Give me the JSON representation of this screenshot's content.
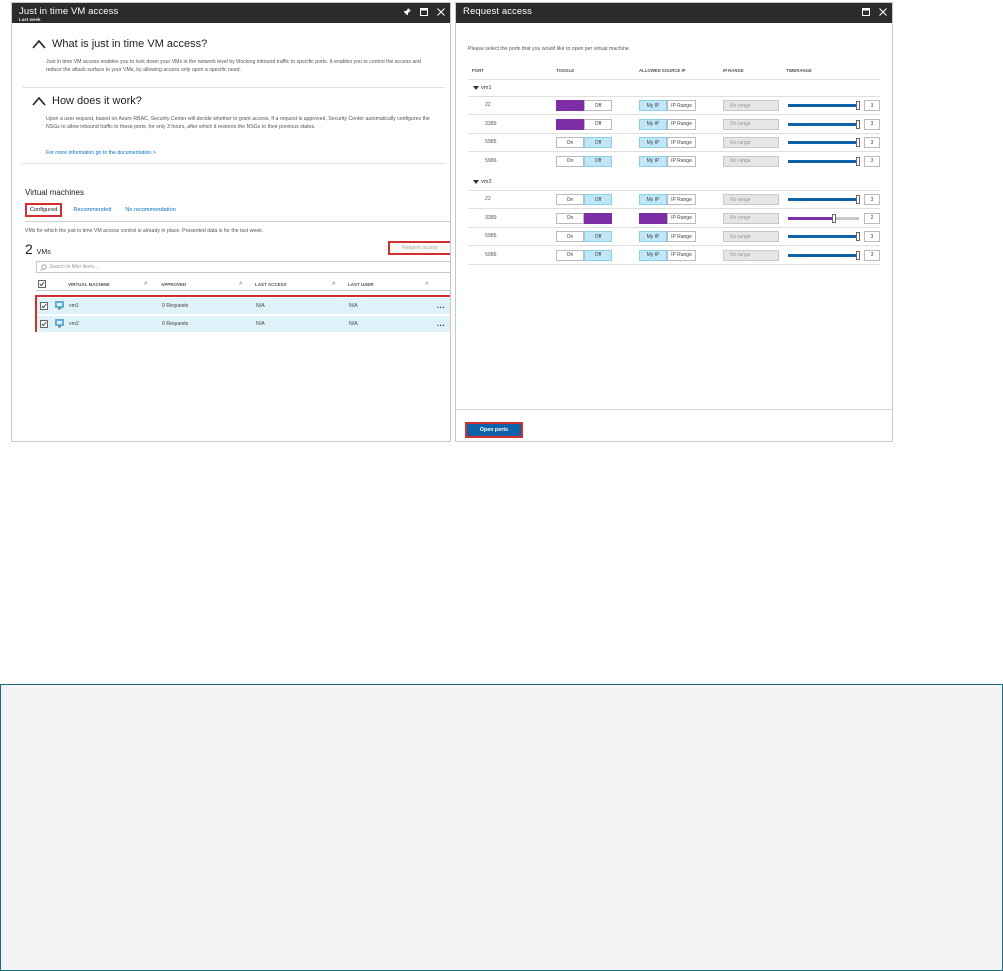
{
  "left_blade": {
    "title": "Just in time VM access",
    "subtitle": "Last week",
    "what_heading": "What is just in time VM access?",
    "what_body": "Just in time VM access enables you to lock down your VMs in the network level by blocking inbound traffic to specific ports. It enables you to control the access and reduce the attack surface to your VMs, by allowing access only upon a specific need.",
    "how_heading": "How does it work?",
    "how_body": "Upon a user request, based on Azure RBAC, Security Center will decide whether to grant access. If a request is approved, Security Center automatically configures the NSGs to allow inbound traffic to these ports, for only 3 hours, after which it restores the NSGs to their previous states.",
    "doc_link": "For more information go to the documentation >",
    "vm_section_title": "Virtual machines",
    "tabs": [
      {
        "label": "Configured"
      },
      {
        "label": "Recommended"
      },
      {
        "label": "No recommendation"
      }
    ],
    "vm_description": "VMs for which the just in time VM access control is already in place. Presented data is for the last week.",
    "vm_count": "2",
    "vm_count_unit": "VMs",
    "request_access_label": "Request access",
    "filter_placeholder": "Search to filter items...",
    "columns": {
      "vm": "VIRTUAL MACHINE",
      "approved": "APPROVED",
      "last_access": "LAST ACCESS",
      "last_user": "LAST USER"
    },
    "rows": [
      {
        "name": "vm1",
        "approved": "0 Requests",
        "last_access": "N/A",
        "last_user": "N/A"
      },
      {
        "name": "vm2",
        "approved": "0 Requests",
        "last_access": "N/A",
        "last_user": "N/A"
      }
    ],
    "more_label": "..."
  },
  "right_blade": {
    "title": "Request access",
    "instruction": "Please select the ports that you would like to open per virtual machine.",
    "columns": {
      "port": "PORT",
      "toggle": "TOGGLE",
      "allowed_source_ip": "ALLOWED SOURCE IP",
      "ip_range": "IP RANGE",
      "timerange": "TIMERANGE"
    },
    "on_label": "On",
    "off_label": "Off",
    "my_ip_label": "My IP",
    "ip_range_label": "IP Range",
    "ip_range_placeholder": "No range",
    "groups": [
      {
        "name": "vm1",
        "ports": [
          {
            "port": "22",
            "toggle": "On",
            "timerange_hours": "3"
          },
          {
            "port": "3389",
            "toggle": "On",
            "timerange_hours": "3"
          },
          {
            "port": "5985",
            "toggle": "Off",
            "timerange_hours": "3"
          },
          {
            "port": "5986",
            "toggle": "Off",
            "timerange_hours": "3"
          }
        ]
      },
      {
        "name": "vm2",
        "ports": [
          {
            "port": "22",
            "toggle": "Off",
            "timerange_hours": "3"
          },
          {
            "port": "3389",
            "toggle": "Off",
            "timerange_hours": "2"
          },
          {
            "port": "5985",
            "toggle": "Off",
            "timerange_hours": "3"
          },
          {
            "port": "5986",
            "toggle": "Off",
            "timerange_hours": "3"
          }
        ]
      }
    ],
    "open_ports_label": "Open ports"
  },
  "colors": {
    "accent_blue": "#0e63a8",
    "link_blue": "#0072c6",
    "highlight_purple": "#7b2ea6",
    "selected_row": "#dff1f9",
    "callout_red": "#d32f2f",
    "header_dark": "#2b2b2b"
  }
}
